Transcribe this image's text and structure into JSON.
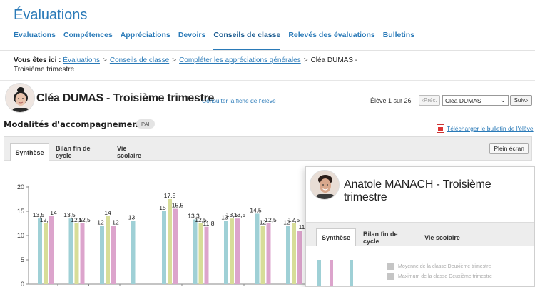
{
  "app": {
    "title": "Évaluations"
  },
  "nav": {
    "items": [
      "Évaluations",
      "Compétences",
      "Appréciations",
      "Devoirs",
      "Conseils de classe",
      "Relevés des évaluations",
      "Bulletins"
    ],
    "active_index": 4
  },
  "breadcrumb": {
    "prefix": "Vous êtes ici :",
    "links": [
      "Évaluations",
      "Conseils de classe",
      "Compléter les appréciations générales"
    ],
    "current": "Cléa DUMAS - Troisième trimestre"
  },
  "student": {
    "title": "Cléa DUMAS - Troisième trimestre",
    "link": "Consulter la fiche de l'élève",
    "position": "Élève 1 sur 26",
    "prev_label": "Préc.",
    "selected": "Cléa DUMAS",
    "next_label": "Suiv."
  },
  "section": {
    "title": "Modalités d'accompagnement",
    "badge": "PAI",
    "download_link": "Télécharger le bulletin de l'élève"
  },
  "tabs": {
    "items": [
      "Synthèse",
      "Bilan fin de cycle",
      "Vie scolaire"
    ],
    "active_index": 0,
    "fullscreen_label": "Plein écran"
  },
  "overlay": {
    "title": "Anatole MANACH - Troisième trimestre",
    "tabs": [
      "Synthèse",
      "Bilan fin de cycle",
      "Vie scolaire"
    ],
    "active_index": 0,
    "legend": [
      "Moyenne de la classe Deuxième trimestre",
      "Maximum de la classe Deuxième trimestre"
    ]
  },
  "colors": {
    "accent": "#2a7ab8",
    "series": [
      "#9fd0d6",
      "#d7dd98",
      "#dca4cc"
    ]
  },
  "chart_data": {
    "type": "bar",
    "ylim": [
      0,
      20
    ],
    "yticks": [
      0,
      5,
      10,
      15,
      20
    ],
    "grid": false,
    "groups": [
      {
        "bars": [
          13.5,
          12.5,
          14
        ],
        "labels": [
          "13,5",
          "12,5",
          "14"
        ]
      },
      {
        "bars": [
          13.5,
          12.5,
          12.5
        ],
        "labels": [
          "13,5",
          "12,5",
          "12,5"
        ]
      },
      {
        "bars": [
          12,
          14,
          12
        ],
        "labels": [
          "12",
          "14",
          "12"
        ]
      },
      {
        "bars": [
          13
        ],
        "labels": [
          "13"
        ]
      },
      {
        "bars": [
          15,
          17.5,
          15.5
        ],
        "labels": [
          "15",
          "17,5",
          "15,5"
        ]
      },
      {
        "bars": [
          13.3,
          12.5,
          11.8
        ],
        "labels": [
          "13,3",
          "12,5",
          "11,8"
        ]
      },
      {
        "bars": [
          13,
          13.5,
          13.5
        ],
        "labels": [
          "13",
          "13,5",
          "13,5"
        ]
      },
      {
        "bars": [
          14.5,
          12,
          12.5
        ],
        "labels": [
          "14,5",
          "12",
          "12,5"
        ]
      },
      {
        "bars": [
          12,
          12.5,
          11
        ],
        "labels": [
          "12",
          "12,5",
          "11"
        ]
      }
    ]
  }
}
